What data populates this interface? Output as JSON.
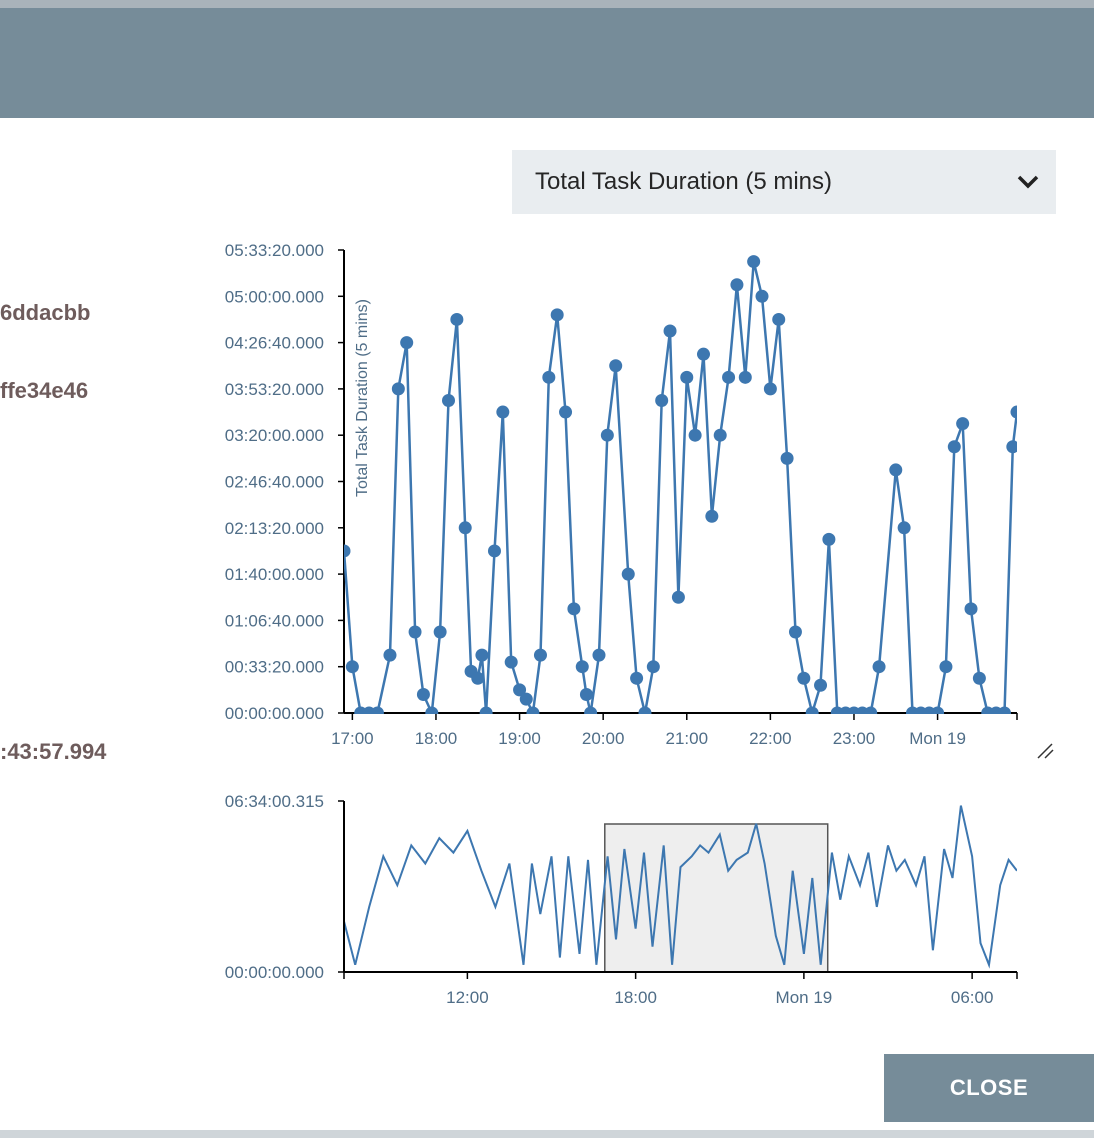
{
  "dialog": {
    "metric_select": {
      "selected": "Total Task Duration (5 mins)",
      "icon": "chevron-down-icon"
    },
    "details": [
      {
        "text": "6ddacbb"
      },
      {
        "text": "ffe34e46"
      },
      {
        "text": ":43:57.994"
      }
    ],
    "close_label": "CLOSE",
    "resize_icon": "resize-handle-icon"
  },
  "colors": {
    "series": "#3d77b0",
    "header": "#768c99",
    "select_bg": "#e9edf0",
    "brush_fill": "#eeeeee"
  },
  "chart_data": [
    {
      "type": "line",
      "markers": true,
      "ylabel": "Total Task Duration (5 mins)",
      "xlabel": "",
      "title": "",
      "ylim_seconds": [
        0,
        20000
      ],
      "ytick_labels": [
        "00:00:00.000",
        "00:33:20.000",
        "01:06:40.000",
        "01:40:00.000",
        "02:13:20.000",
        "02:46:40.000",
        "03:20:00.000",
        "03:53:20.000",
        "04:26:40.000",
        "05:00:00.000",
        "05:33:20.000"
      ],
      "xtick_labels": [
        "17:00",
        "18:00",
        "19:00",
        "20:00",
        "21:00",
        "22:00",
        "23:00",
        "Mon 19"
      ],
      "xlim_hours": [
        16.9,
        24.95
      ],
      "series": [
        {
          "x_hours": [
            16.9,
            17.0,
            17.1,
            17.2,
            17.3,
            17.45,
            17.55,
            17.65,
            17.75,
            17.85,
            17.95,
            18.05,
            18.15,
            18.25,
            18.35,
            18.42,
            18.5,
            18.55,
            18.6,
            18.7,
            18.8,
            18.9,
            19.0,
            19.08,
            19.16,
            19.25,
            19.35,
            19.45,
            19.55,
            19.65,
            19.75,
            19.8,
            19.85,
            19.95,
            20.05,
            20.15,
            20.3,
            20.4,
            20.5,
            20.6,
            20.7,
            20.8,
            20.9,
            21.0,
            21.1,
            21.2,
            21.3,
            21.4,
            21.5,
            21.6,
            21.7,
            21.8,
            21.9,
            22.0,
            22.1,
            22.2,
            22.3,
            22.4,
            22.5,
            22.6,
            22.7,
            22.8,
            22.9,
            23.0,
            23.1,
            23.2,
            23.3,
            23.5,
            23.6,
            23.7,
            23.8,
            23.9,
            24.0,
            24.1,
            24.2,
            24.3,
            24.4,
            24.5,
            24.6,
            24.7,
            24.8,
            24.9,
            24.95
          ],
          "y_seconds": [
            7000,
            2000,
            0,
            0,
            0,
            2500,
            14000,
            16000,
            3500,
            800,
            0,
            3500,
            13500,
            17000,
            8000,
            1800,
            1500,
            2500,
            0,
            7000,
            13000,
            2200,
            1000,
            600,
            0,
            2500,
            14500,
            17200,
            13000,
            4500,
            2000,
            800,
            0,
            2500,
            12000,
            15000,
            6000,
            1500,
            0,
            2000,
            13500,
            16500,
            5000,
            14500,
            12000,
            15500,
            8500,
            12000,
            14500,
            18500,
            14500,
            19500,
            18000,
            14000,
            17000,
            11000,
            3500,
            1500,
            0,
            1200,
            7500,
            0,
            0,
            0,
            0,
            0,
            2000,
            10500,
            8000,
            0,
            0,
            0,
            0,
            2000,
            11500,
            12500,
            4500,
            1500,
            0,
            0,
            0,
            11500,
            13000
          ]
        }
      ]
    },
    {
      "type": "area",
      "role": "overview-brush",
      "ylim_labels": [
        "00:00:00.000",
        "06:34:00.315"
      ],
      "ylim_seconds": [
        0,
        23640.315
      ],
      "xtick_labels": [
        "12:00",
        "18:00",
        "Mon 19",
        "06:00"
      ],
      "xlim_hours": [
        7.6,
        31.6
      ],
      "brush_hours": [
        16.9,
        24.85
      ],
      "series": [
        {
          "x_hours": [
            7.6,
            8.0,
            8.5,
            9.0,
            9.5,
            10.0,
            10.5,
            11.0,
            11.5,
            12.0,
            12.5,
            13.0,
            13.5,
            14.0,
            14.3,
            14.6,
            15.0,
            15.3,
            15.6,
            16.0,
            16.3,
            16.6,
            17.0,
            17.3,
            17.6,
            18.0,
            18.3,
            18.6,
            19.0,
            19.3,
            19.6,
            20.0,
            20.3,
            20.6,
            21.0,
            21.3,
            21.6,
            22.0,
            22.3,
            22.6,
            23.0,
            23.3,
            23.6,
            24.0,
            24.3,
            24.6,
            25.0,
            25.3,
            25.6,
            26.0,
            26.3,
            26.6,
            27.0,
            27.3,
            27.6,
            28.0,
            28.3,
            28.6,
            29.0,
            29.3,
            29.6,
            30.0,
            30.3,
            30.6,
            31.0,
            31.3,
            31.6
          ],
          "y_seconds": [
            7000,
            1000,
            9000,
            16000,
            12000,
            17500,
            15000,
            18500,
            16500,
            19500,
            14000,
            9000,
            15000,
            1000,
            15000,
            8000,
            16000,
            2000,
            16000,
            2500,
            15500,
            1000,
            16000,
            4500,
            17000,
            6000,
            16500,
            3500,
            17500,
            1000,
            14500,
            16000,
            17500,
            16500,
            19000,
            14000,
            15500,
            16500,
            20500,
            15000,
            5000,
            1000,
            14000,
            2500,
            13000,
            1000,
            16500,
            10000,
            16000,
            12000,
            16500,
            9000,
            17500,
            14000,
            15500,
            12000,
            16000,
            3000,
            17000,
            13000,
            23000,
            16000,
            4000,
            1000,
            12000,
            15500,
            14000
          ]
        }
      ]
    }
  ]
}
